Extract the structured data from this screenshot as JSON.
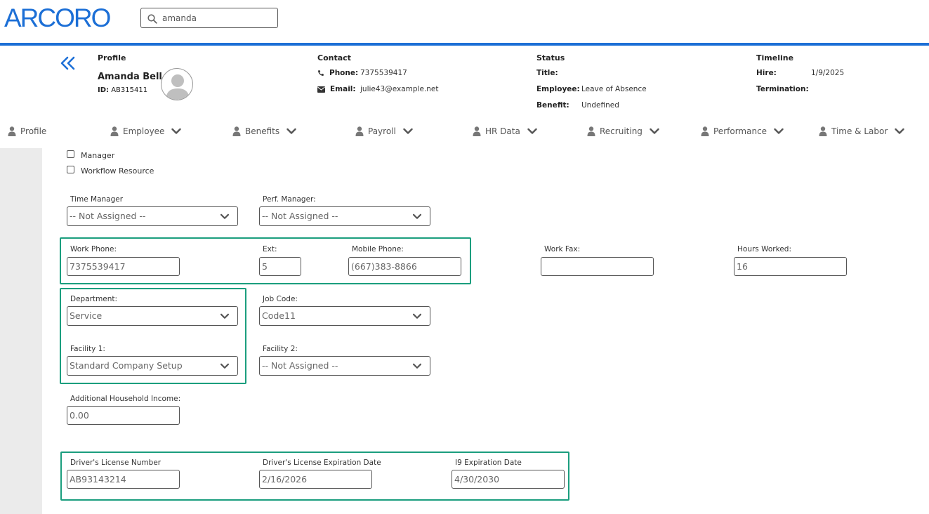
{
  "header": {
    "logo_text": "ARCORO",
    "search": {
      "value": "amanda"
    }
  },
  "profile": {
    "section_title": "Profile",
    "name": "Amanda Bell",
    "id_label": "ID:",
    "id_value": "AB315411"
  },
  "contact": {
    "section_title": "Contact",
    "phone_label": "Phone:",
    "phone_value": "7375539417",
    "email_label": "Email:",
    "email_value": "julie43@example.net"
  },
  "status": {
    "section_title": "Status",
    "title_label": "Title:",
    "title_value": "",
    "employee_label": "Employee:",
    "employee_value": "Leave of Absence",
    "benefit_label": "Benefit:",
    "benefit_value": "Undefined"
  },
  "timeline": {
    "section_title": "Timeline",
    "hire_label": "Hire:",
    "hire_value": "1/9/2025",
    "termination_label": "Termination:",
    "termination_value": ""
  },
  "nav": {
    "items": [
      {
        "label": "Profile"
      },
      {
        "label": "Employee"
      },
      {
        "label": "Benefits"
      },
      {
        "label": "Payroll"
      },
      {
        "label": "HR Data"
      },
      {
        "label": "Recruiting"
      },
      {
        "label": "Performance"
      },
      {
        "label": "Time & Labor"
      }
    ]
  },
  "form": {
    "manager_label": "Manager",
    "workflow_label": "Workflow Resource",
    "time_manager": {
      "label": "Time Manager",
      "value": "-- Not Assigned --"
    },
    "perf_manager": {
      "label": "Perf. Manager:",
      "value": "-- Not Assigned --"
    },
    "work_phone": {
      "label": "Work Phone:",
      "value": "7375539417"
    },
    "ext": {
      "label": "Ext:",
      "value": "5"
    },
    "mobile_phone": {
      "label": "Mobile Phone:",
      "value": "(667)383-8866"
    },
    "work_fax": {
      "label": "Work Fax:",
      "value": ""
    },
    "hours_worked": {
      "label": "Hours Worked:",
      "value": "16"
    },
    "department": {
      "label": "Department:",
      "value": "Service"
    },
    "job_code": {
      "label": "Job Code:",
      "value": "Code11"
    },
    "facility1": {
      "label": "Facility 1:",
      "value": "Standard Company Setup"
    },
    "facility2": {
      "label": "Facility 2:",
      "value": "-- Not Assigned --"
    },
    "household_income": {
      "label": "Additional Household Income:",
      "value": "0.00"
    },
    "dl_number": {
      "label": "Driver's License Number",
      "value": "AB93143214"
    },
    "dl_expiration": {
      "label": "Driver's License Expiration Date",
      "value": "2/16/2026"
    },
    "i9_expiration": {
      "label": "I9 Expiration Date",
      "value": "4/30/2030"
    }
  },
  "colors": {
    "brand_blue": "#1c6fd6",
    "highlight_green": "#1b9e7e"
  }
}
